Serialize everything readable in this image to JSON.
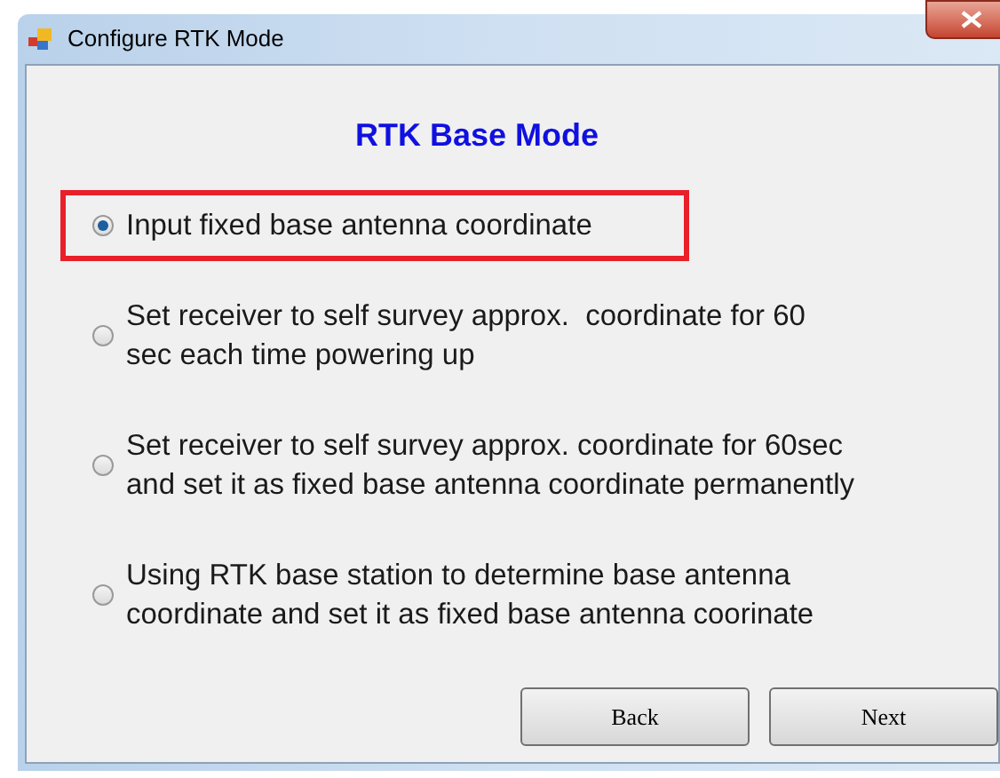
{
  "window": {
    "title": "Configure RTK Mode"
  },
  "heading": "RTK Base Mode",
  "options": [
    {
      "lines": [
        "Input fixed base antenna coordinate"
      ],
      "selected": true,
      "highlighted": true
    },
    {
      "lines": [
        "Set receiver to self survey approx.  coordinate for 60",
        "sec each time powering up"
      ],
      "selected": false,
      "highlighted": false
    },
    {
      "lines": [
        "Set receiver to self survey approx. coordinate for 60sec",
        "and set it as fixed base antenna coordinate permanently"
      ],
      "selected": false,
      "highlighted": false
    },
    {
      "lines": [
        "Using RTK base station to determine base antenna",
        "coordinate and set it as fixed base antenna coorinate"
      ],
      "selected": false,
      "highlighted": false
    }
  ],
  "buttons": [
    "Back",
    "Next"
  ]
}
